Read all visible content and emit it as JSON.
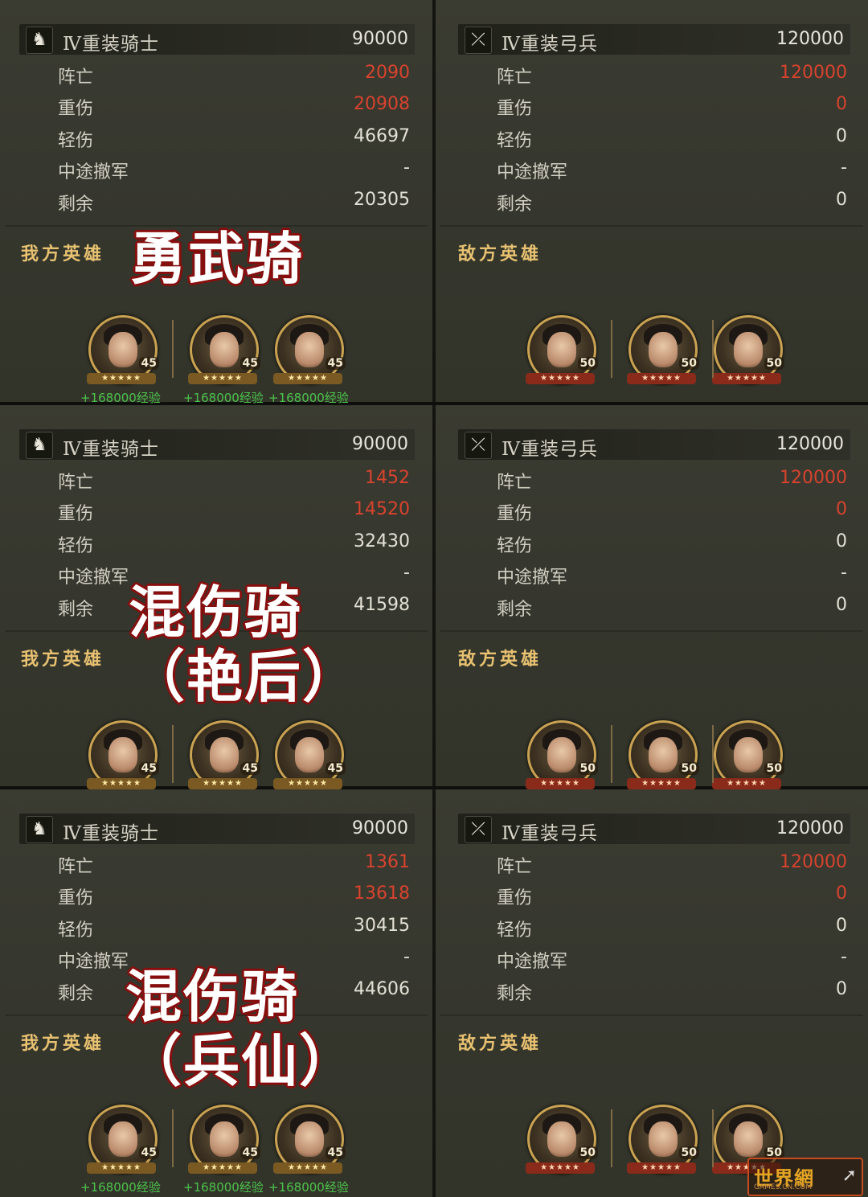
{
  "sections": [
    {
      "left": {
        "unit_name": "Ⅳ重装骑士",
        "unit_total": "90000",
        "unit_icon": "horse-head-icon",
        "stats": [
          {
            "label": "阵亡",
            "value": "2090",
            "highlight": true
          },
          {
            "label": "重伤",
            "value": "20908",
            "highlight": true
          },
          {
            "label": "轻伤",
            "value": "46697",
            "highlight": false
          },
          {
            "label": "中途撤军",
            "value": "-",
            "highlight": false
          },
          {
            "label": "剩余",
            "value": "20305",
            "highlight": false
          }
        ],
        "heroes_title": "我方英雄",
        "overlay": [
          "勇武骑"
        ],
        "heroes": [
          {
            "level": "45"
          },
          {
            "level": "45"
          },
          {
            "level": "45"
          }
        ],
        "exp": [
          "+168000经验",
          "+168000经验",
          "+168000经验"
        ]
      },
      "right": {
        "unit_name": "Ⅳ重装弓兵",
        "unit_total": "120000",
        "unit_icon": "crossbow-icon",
        "stats": [
          {
            "label": "阵亡",
            "value": "120000",
            "highlight": true
          },
          {
            "label": "重伤",
            "value": "0",
            "highlight": true
          },
          {
            "label": "轻伤",
            "value": "0",
            "highlight": false
          },
          {
            "label": "中途撤军",
            "value": "-",
            "highlight": false
          },
          {
            "label": "剩余",
            "value": "0",
            "highlight": false
          }
        ],
        "heroes_title": "敌方英雄",
        "heroes": [
          {
            "level": "50"
          },
          {
            "level": "50"
          },
          {
            "level": "50"
          }
        ]
      }
    },
    {
      "left": {
        "unit_name": "Ⅳ重装骑士",
        "unit_total": "90000",
        "unit_icon": "horse-head-icon",
        "stats": [
          {
            "label": "阵亡",
            "value": "1452",
            "highlight": true
          },
          {
            "label": "重伤",
            "value": "14520",
            "highlight": true
          },
          {
            "label": "轻伤",
            "value": "32430",
            "highlight": false
          },
          {
            "label": "中途撤军",
            "value": "-",
            "highlight": false
          },
          {
            "label": "剩余",
            "value": "41598",
            "highlight": false
          }
        ],
        "heroes_title": "我方英雄",
        "overlay": [
          "混伤骑",
          "（艳后）"
        ],
        "heroes": [
          {
            "level": "45"
          },
          {
            "level": "45"
          },
          {
            "level": "45"
          }
        ],
        "exp": []
      },
      "right": {
        "unit_name": "Ⅳ重装弓兵",
        "unit_total": "120000",
        "unit_icon": "crossbow-icon",
        "stats": [
          {
            "label": "阵亡",
            "value": "120000",
            "highlight": true
          },
          {
            "label": "重伤",
            "value": "0",
            "highlight": true
          },
          {
            "label": "轻伤",
            "value": "0",
            "highlight": false
          },
          {
            "label": "中途撤军",
            "value": "-",
            "highlight": false
          },
          {
            "label": "剩余",
            "value": "0",
            "highlight": false
          }
        ],
        "heroes_title": "敌方英雄",
        "heroes": [
          {
            "level": "50"
          },
          {
            "level": "50"
          },
          {
            "level": "50"
          }
        ]
      }
    },
    {
      "left": {
        "unit_name": "Ⅳ重装骑士",
        "unit_total": "90000",
        "unit_icon": "horse-head-icon",
        "stats": [
          {
            "label": "阵亡",
            "value": "1361",
            "highlight": true
          },
          {
            "label": "重伤",
            "value": "13618",
            "highlight": true
          },
          {
            "label": "轻伤",
            "value": "30415",
            "highlight": false
          },
          {
            "label": "中途撤军",
            "value": "-",
            "highlight": false
          },
          {
            "label": "剩余",
            "value": "44606",
            "highlight": false
          }
        ],
        "heroes_title": "我方英雄",
        "overlay": [
          "混伤骑",
          "（兵仙）"
        ],
        "heroes": [
          {
            "level": "45"
          },
          {
            "level": "45"
          },
          {
            "level": "45"
          }
        ],
        "exp": [
          "+168000经验",
          "+168000经验",
          "+168000经验"
        ]
      },
      "right": {
        "unit_name": "Ⅳ重装弓兵",
        "unit_total": "120000",
        "unit_icon": "crossbow-icon",
        "stats": [
          {
            "label": "阵亡",
            "value": "120000",
            "highlight": true
          },
          {
            "label": "重伤",
            "value": "0",
            "highlight": true
          },
          {
            "label": "轻伤",
            "value": "0",
            "highlight": false
          },
          {
            "label": "中途撤军",
            "value": "-",
            "highlight": false
          },
          {
            "label": "剩余",
            "value": "0",
            "highlight": false
          }
        ],
        "heroes_title": "敌方英雄",
        "heroes": [
          {
            "level": "50"
          },
          {
            "level": "50"
          },
          {
            "level": "50"
          }
        ]
      }
    }
  ],
  "stars": "★★★★★",
  "watermark": {
    "text": "世界網",
    "sub": "GAMES.CN.COM",
    "icon": "cursor-icon"
  },
  "colors": {
    "damage_red": "#d8432e",
    "exp_green": "#4cc24c",
    "gold": "#e8c271"
  }
}
